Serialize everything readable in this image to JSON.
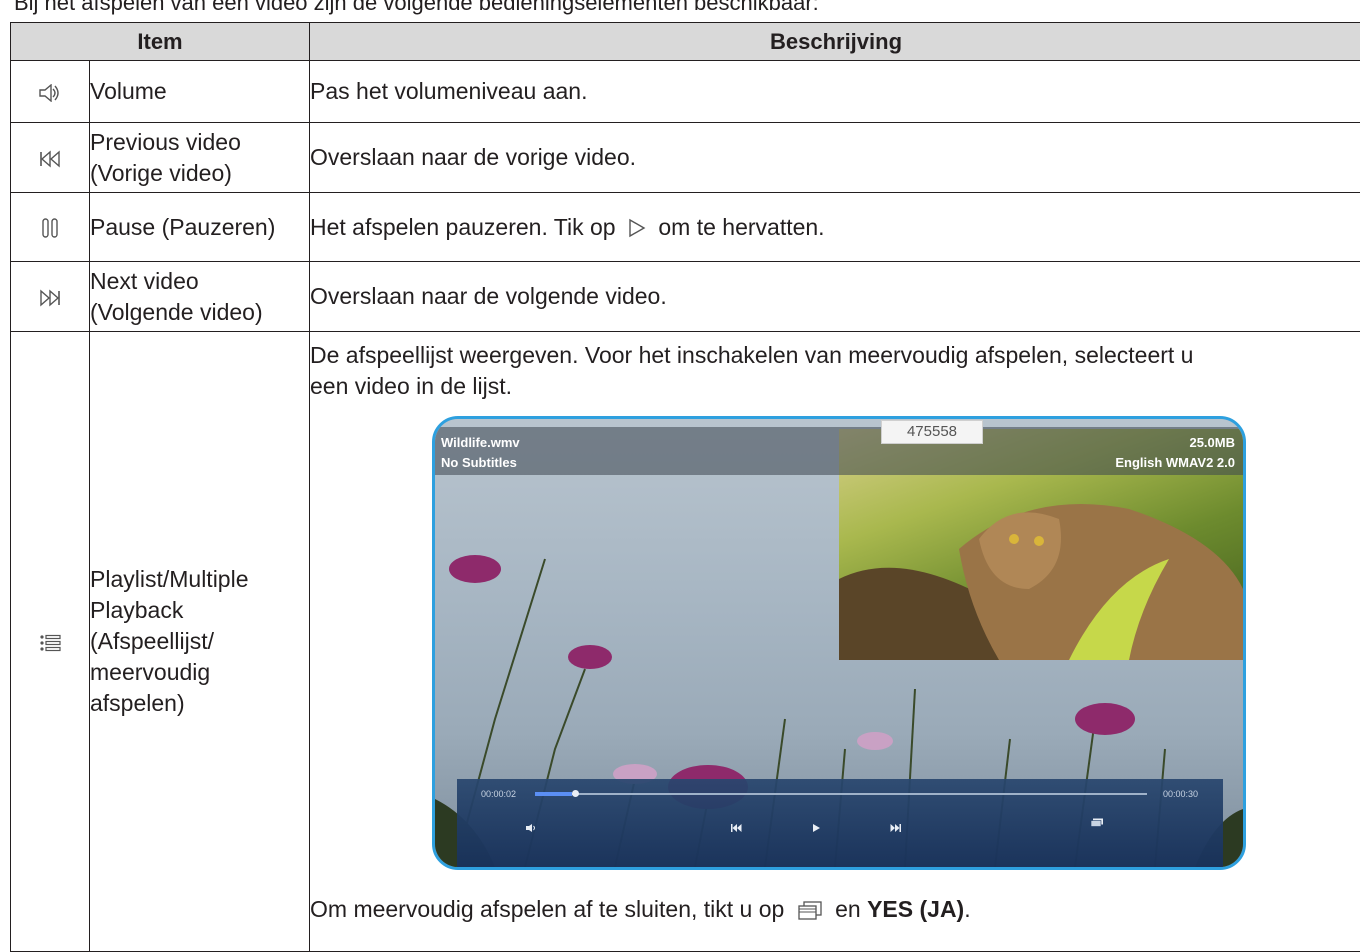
{
  "intro": "Bij het afspelen van een video zijn de volgende bedieningselementen beschikbaar:",
  "table": {
    "header_item": "Item",
    "header_desc": "Beschrijving",
    "rows": [
      {
        "icon": "volume-icon",
        "item": "Volume",
        "desc": "Pas het volumeniveau aan."
      },
      {
        "icon": "previous-icon",
        "item_line1": "Previous video",
        "item_line2": "(Vorige video)",
        "desc": "Overslaan naar de vorige video."
      },
      {
        "icon": "pause-icon",
        "item": "Pause (Pauzeren)",
        "desc_a": "Het afspelen pauzeren. Tik op",
        "desc_b": "om te hervatten.",
        "inline_icon": "play-icon"
      },
      {
        "icon": "next-icon",
        "item_line1": "Next video",
        "item_line2": "(Volgende video)",
        "desc": "Overslaan naar de volgende video."
      },
      {
        "icon": "playlist-icon",
        "item_lines": [
          "Playlist/Multiple",
          "Playback",
          "(Afspeellijst/",
          "meervoudig",
          "afspelen)"
        ],
        "desc_line1": "De afspeellijst weergeven. Voor het inschakelen van meervoudig afspelen, selecteert u",
        "desc_line2": "een video in de lijst.",
        "footer_a": "Om meervoudig afspelen af te sluiten, tikt u op",
        "footer_bold": "YES (JA)",
        "footer_b": "en",
        "footer_end": ".",
        "footer_icon": "multi-window-icon"
      }
    ]
  },
  "screenshot": {
    "filename": "Wildlife.wmv",
    "subtitles": "No Subtitles",
    "counter": "475558",
    "size": "25.0MB",
    "audio": "English WMAV2 2.0",
    "time_current": "00:00:02",
    "time_total": "00:00:30",
    "progress_fraction": 0.06
  }
}
